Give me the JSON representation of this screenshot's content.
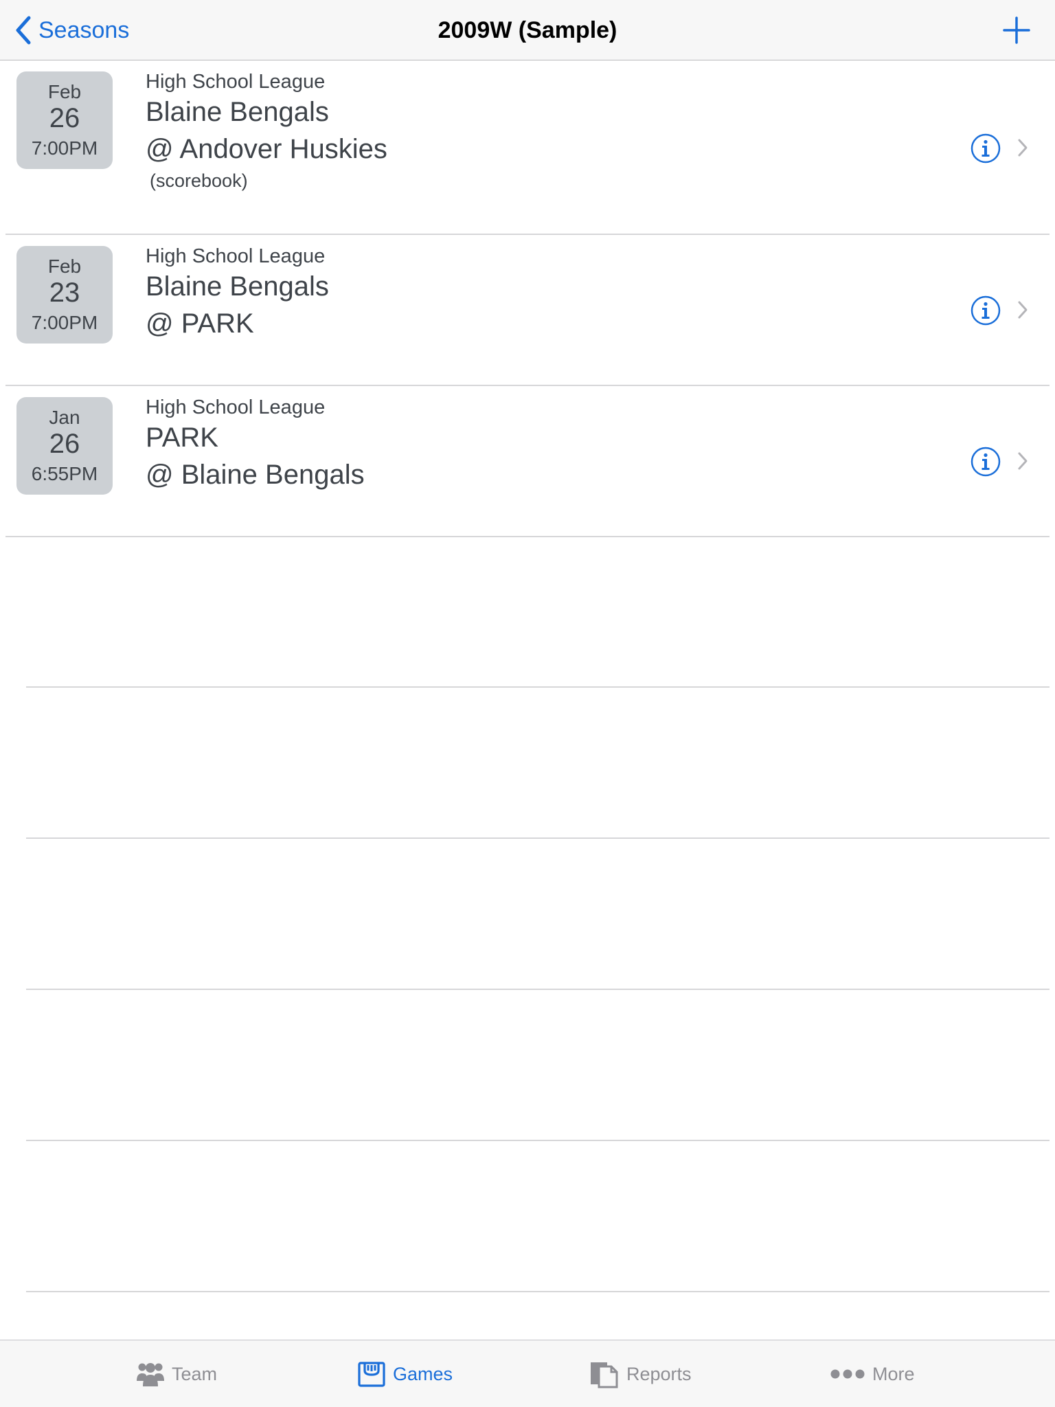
{
  "navbar": {
    "back_label": "Seasons",
    "title": "2009W (Sample)"
  },
  "games": [
    {
      "month": "Feb",
      "day": "26",
      "time": "7:00PM",
      "league": "High School League",
      "home": "Blaine Bengals",
      "away": "@ Andover Huskies",
      "note": "(scorebook)"
    },
    {
      "month": "Feb",
      "day": "23",
      "time": "7:00PM",
      "league": "High School League",
      "home": "Blaine Bengals",
      "away": "@ PARK",
      "note": ""
    },
    {
      "month": "Jan",
      "day": "26",
      "time": "6:55PM",
      "league": "High School League",
      "home": "PARK",
      "away": "@ Blaine Bengals",
      "note": ""
    }
  ],
  "tabs": [
    {
      "label": "Team",
      "icon": "team-icon",
      "active": false
    },
    {
      "label": "Games",
      "icon": "games-icon",
      "active": true
    },
    {
      "label": "Reports",
      "icon": "reports-icon",
      "active": false
    },
    {
      "label": "More",
      "icon": "more-icon",
      "active": false
    }
  ],
  "colors": {
    "accent": "#1a6ed9",
    "badge": "#ccd0d4",
    "text": "#3e4349",
    "inactive": "#8e8e93"
  }
}
